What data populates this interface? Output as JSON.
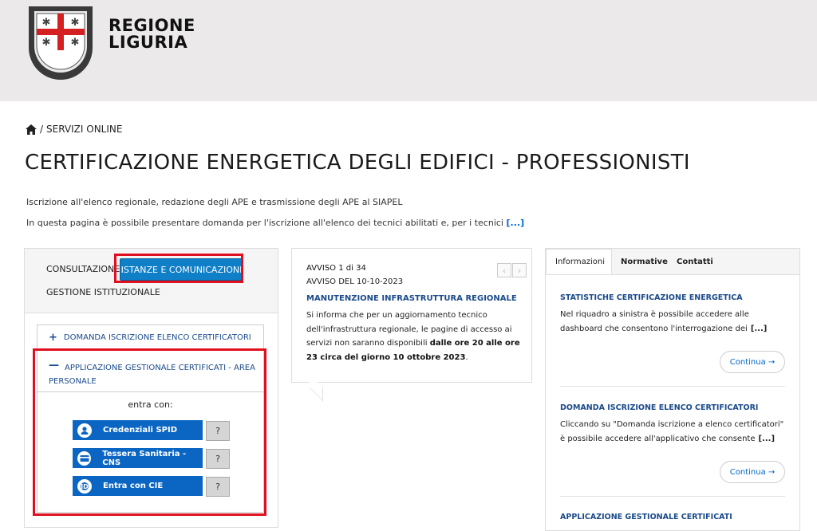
{
  "header": {
    "brand_line1": "REGIONE",
    "brand_line2": "LIGURIA"
  },
  "breadcrumb": {
    "home_icon": "home-icon",
    "separator": "/",
    "current": "SERVIZI ONLINE"
  },
  "page": {
    "title": "CERTIFICAZIONE ENERGETICA DEGLI EDIFICI - PROFESSIONISTI",
    "subtitle": "Iscrizione all'elenco regionale, redazione degli APE e trasmissione degli APE al SIAPEL",
    "intro": "In questa pagina è possibile presentare domanda per l'iscrizione all'elenco dei tecnici abilitati e, per i tecnici",
    "intro_more": "[...]"
  },
  "left_panel": {
    "tabs": {
      "consultazione": "CONSULTAZIONE",
      "istanze": "ISTANZE E COMUNICAZIONI",
      "gestione": "GESTIONE ISTITUZIONALE"
    },
    "accordion1": {
      "sign": "+",
      "label": "DOMANDA ISCRIZIONE ELENCO CERTIFICATORI"
    },
    "accordion2": {
      "sign": "—",
      "label": "APPLICAZIONE GESTIONALE CERTIFICATI - AREA PERSONALE"
    },
    "entra_con": "entra con:",
    "login_buttons": [
      {
        "label": "Credenziali SPID",
        "icon": "user-icon",
        "help": "?"
      },
      {
        "label": "Tessera Sanitaria - CNS",
        "icon": "card-icon",
        "help": "?"
      },
      {
        "label": "Entra con CIE",
        "icon": "cie-icon",
        "help": "?"
      }
    ]
  },
  "avviso": {
    "counter": "AVVISO 1 di 34",
    "date": "AVVISO DEL 10-10-2023",
    "title": "MANUTENZIONE INFRASTRUTTURA REGIONALE",
    "body": "Si informa che per un aggiornamento tecnico dell'infrastruttura regionale, le pagine di accesso ai servizi non saranno disponibili ",
    "body_bold": "dalle ore 20 alle ore 23 circa del giorno 10 ottobre 2023",
    "body_end": ".",
    "prev": "‹",
    "next": "›"
  },
  "right_panel": {
    "tabs": [
      "Informazioni",
      "Normative",
      "Contatti"
    ],
    "sections": [
      {
        "title": "STATISTICHE CERTIFICAZIONE ENERGETICA",
        "text": "Nel riquadro a sinistra è possibile accedere alle dashboard che consentono l'interrogazione dei",
        "more": "[...]",
        "button": "Continua →"
      },
      {
        "title": "DOMANDA ISCRIZIONE ELENCO CERTIFICATORI",
        "text": "Cliccando su \"Domanda iscrizione a elenco certificatori\" è possibile accedere all'applicativo che consente",
        "more": "[...]",
        "button": "Continua →"
      },
      {
        "title": "APPLICAZIONE GESTIONALE CERTIFICATI"
      }
    ]
  },
  "colors": {
    "accent": "#0f7fc8",
    "highlight": "#e01020",
    "link": "#1a4a8a",
    "header_bg": "#ebe9e9"
  }
}
